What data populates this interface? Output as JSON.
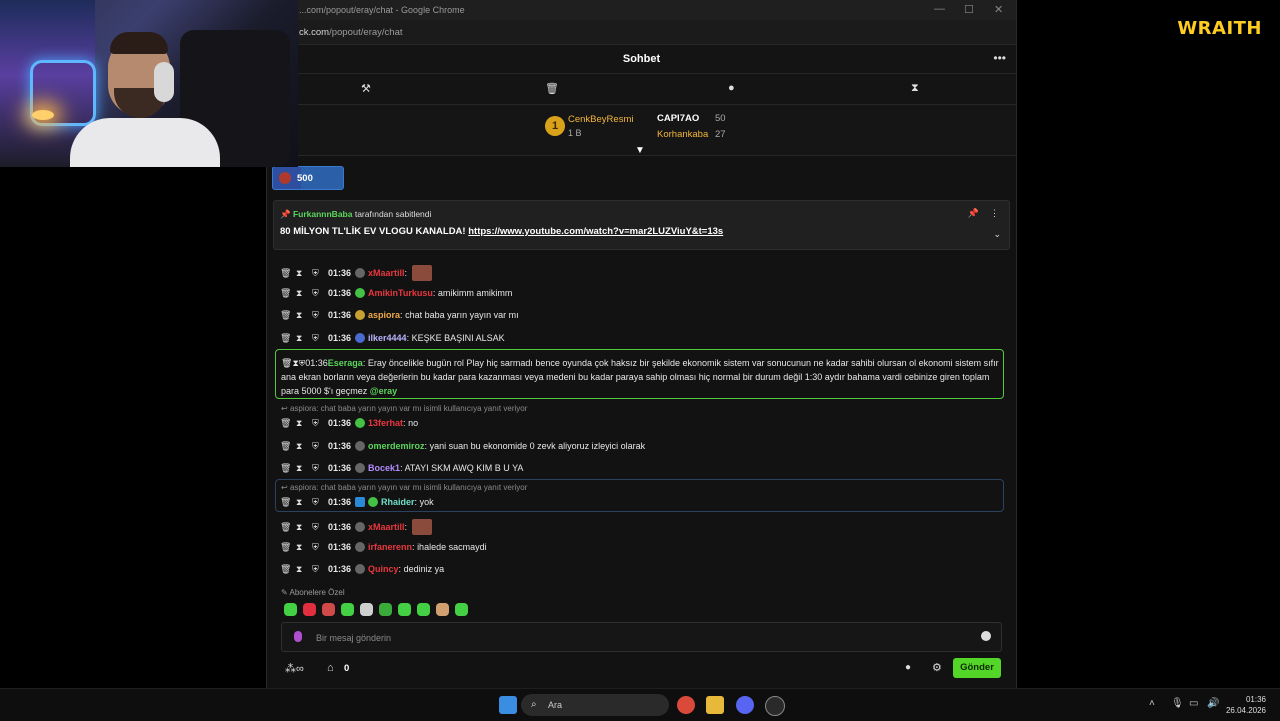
{
  "window": {
    "title": "...com/popout/eray/chat - Google Chrome",
    "url_prefix": "ck.com",
    "url_path": "/popout/eray/chat"
  },
  "brand": "WRAITH",
  "chat": {
    "title": "Sohbet",
    "more": "•••",
    "mod_icons": [
      "gavel-icon",
      "trash-icon",
      "chat-bubble-icon",
      "hourglass-icon"
    ]
  },
  "leaderboard": {
    "first": {
      "rank": "1",
      "name": "CenkBeyResmi",
      "sub": "1 B"
    },
    "others": [
      {
        "name": "CAPI7AO",
        "value": "50"
      },
      {
        "name": "Korhankaba",
        "value": "27"
      }
    ]
  },
  "goal": {
    "value": "500",
    "progress": 0.4
  },
  "pinned": {
    "user": "FurkannnBaba",
    "suffix": "tarafından sabitlendi",
    "message": "80 MİLYON TL'LİK EV VLOGU KANALDA!",
    "link": "https://www.youtube.com/watch?v=mar2LUZViuY&t=13s"
  },
  "messages": [
    {
      "time": "01:36",
      "user": "xMaartill",
      "text": "",
      "color": "#e8373f"
    },
    {
      "time": "01:36",
      "user": "AmikinTurkusu",
      "text": "amikimm amikimm",
      "color": "#e8373f"
    },
    {
      "time": "01:36",
      "user": "aspiora",
      "text": "chat baba yarın yayın var mı",
      "color": "#f0a94a"
    },
    {
      "time": "01:36",
      "user": "ilker4444",
      "text": "KEŞKE BAŞINI ALSAK",
      "color": "#b8b4ff"
    },
    {
      "time": "01:36",
      "user": "Eseraga",
      "text": "Eray öncelikle bugün rol Play hiç sarmadı bence oyunda çok haksız bir şekilde ekonomik sistem var sonucunun ne kadar sahibi olursan ol ekonomi sistem sıfır ana ekran borların veya değerlerin bu kadar para kazanması veya medeni bu kadar paraya sahip olması hiç normal bir durum değil 1:30 aydır bahama vardi cebinize giren toplam para 5000 $'ı geçmez",
      "mention": "@eray",
      "color": "#5cd65c"
    },
    {
      "time": "01:36",
      "user": "13ferhat",
      "text": "no",
      "color": "#e8373f"
    },
    {
      "time": "01:36",
      "user": "omerdemiroz",
      "text": "yani suan bu ekonomide 0 zevk aliyoruz izleyici olarak",
      "color": "#5cd65c"
    },
    {
      "time": "01:36",
      "user": "Bocek1",
      "text": "ATAYI SKM AWQ KIM B U YA",
      "color": "#b38cff"
    },
    {
      "time": "01:36",
      "user": "Rhaider",
      "text": "yok",
      "color": "#6ee0c8"
    },
    {
      "time": "01:36",
      "user": "xMaartill",
      "text": "",
      "color": "#e8373f"
    },
    {
      "time": "01:36",
      "user": "irfanerenn",
      "text": "ihalede sacmaydi",
      "color": "#e8373f"
    },
    {
      "time": "01:36",
      "user": "Quincy",
      "text": "dediniz ya",
      "color": "#e8373f"
    }
  ],
  "reply_note": "aspiora: chat baba yarın yayın var mı isimli kullanıcıya yanıt veriyor",
  "sub_emotes_label": "Abonelere Özel",
  "input": {
    "placeholder": "Bir mesaj gönderin",
    "send": "Gönder",
    "points": "0"
  },
  "taskbar": {
    "search": "Ara",
    "time": "01:36",
    "date": "26.04.2026"
  }
}
